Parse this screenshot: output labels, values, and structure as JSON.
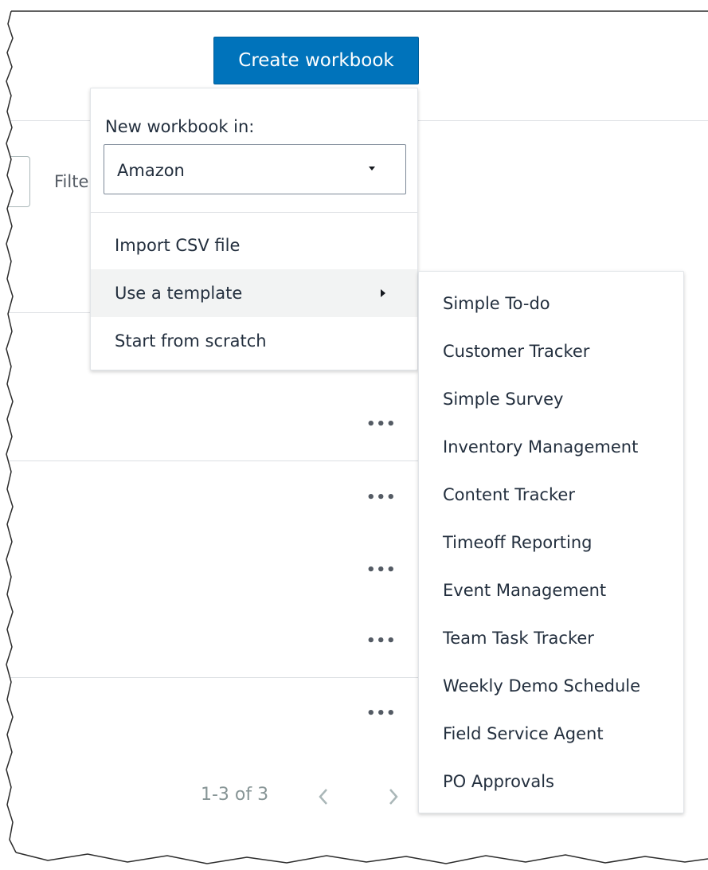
{
  "create_button": {
    "label": "Create workbook"
  },
  "dropdown": {
    "label": "New workbook in:",
    "select_value": "Amazon",
    "items": [
      {
        "label": "Import CSV file"
      },
      {
        "label": "Use a template",
        "has_submenu": true
      },
      {
        "label": "Start from scratch"
      }
    ]
  },
  "background": {
    "filter_label": "Filte",
    "row_menu_label": "•••",
    "pagination": {
      "text": "1-3 of 3"
    }
  },
  "submenu": {
    "items": [
      "Simple To-do",
      "Customer Tracker",
      "Simple Survey",
      "Inventory Management",
      "Content Tracker",
      "Timeoff Reporting",
      "Event Management",
      "Team Task Tracker",
      "Weekly Demo Schedule",
      "Field Service Agent",
      "PO Approvals"
    ]
  },
  "colors": {
    "primary_button": "#0073bb",
    "text": "#232f3e",
    "muted_text": "#879596",
    "hover_bg": "#f2f3f3"
  },
  "icons": [
    "chevron-down-icon",
    "chevron-right-icon",
    "ellipsis-icon",
    "chevron-left-icon"
  ]
}
